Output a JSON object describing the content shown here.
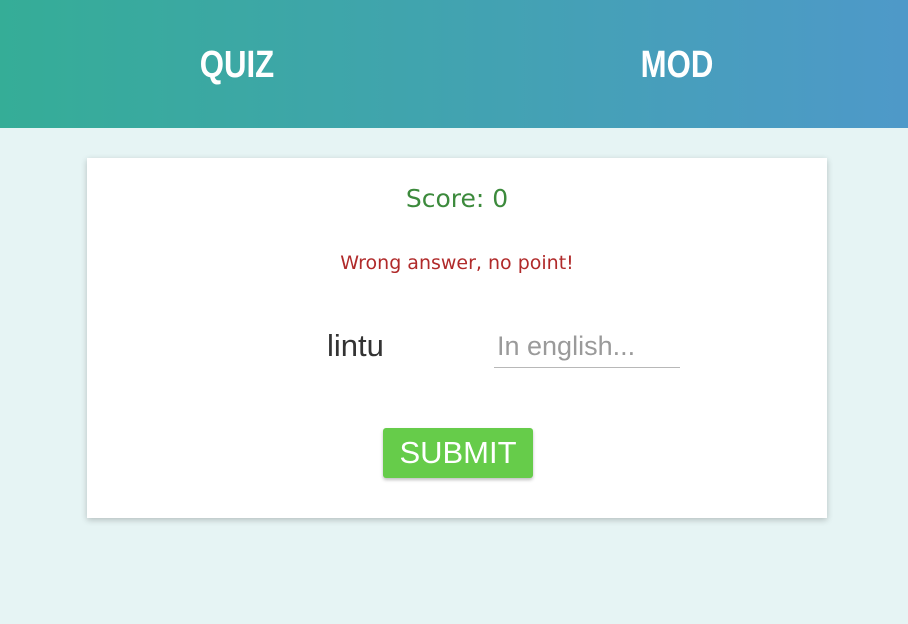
{
  "header": {
    "nav": {
      "quiz_label": "QUIZ",
      "mod_label": "MOD"
    },
    "gradient_start": "#35ad97",
    "gradient_end": "#4e99c9"
  },
  "quiz": {
    "score_label": "Score:",
    "score_value": "0",
    "feedback": "Wrong answer, no point!",
    "word": "lintu",
    "answer_input": {
      "value": "",
      "placeholder": "In english..."
    },
    "submit_label": "SUBMIT"
  },
  "colors": {
    "score": "#3c8a3c",
    "feedback_error": "#b02a2a",
    "submit_button": "#66cc4a",
    "background": "#e6f4f4"
  }
}
